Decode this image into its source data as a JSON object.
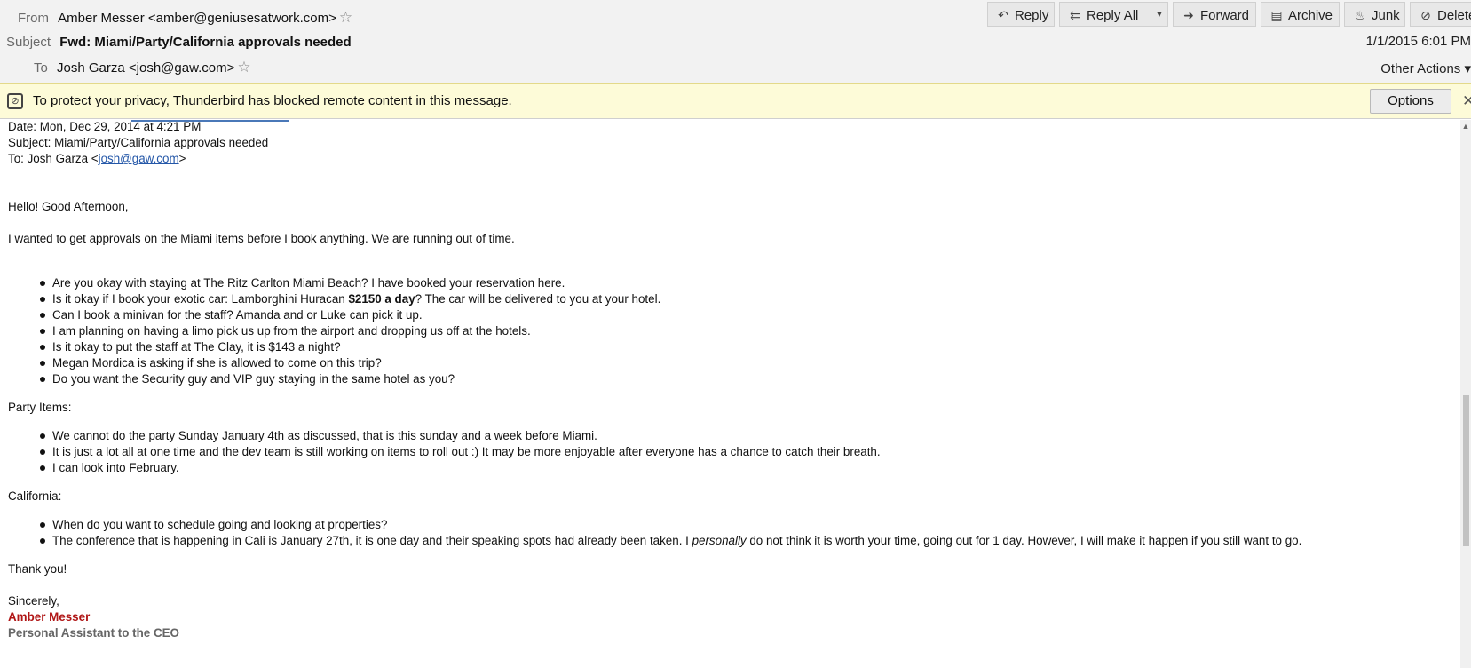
{
  "header": {
    "from_label": "From",
    "from_value": "Amber Messer <amber@geniusesatwork.com>",
    "subject_label": "Subject",
    "subject_value": "Fwd: Miami/Party/California approvals needed",
    "to_label": "To",
    "to_value": "Josh Garza <josh@gaw.com>",
    "date": "1/1/2015 6:01 PM",
    "other_actions": "Other Actions ▾"
  },
  "toolbar": {
    "reply": "Reply",
    "reply_all": "Reply All",
    "forward": "Forward",
    "archive": "Archive",
    "junk": "Junk",
    "delete": "Delete"
  },
  "notification": {
    "text": "To protect your privacy, Thunderbird has blocked remote content in this message.",
    "options": "Options"
  },
  "message": {
    "date_line": "Date: Mon, Dec 29, 2014 at 4:21 PM",
    "subject_line": "Subject: Miami/Party/California approvals needed",
    "to_prefix": "To: Josh Garza <",
    "to_link": "josh@gaw.com",
    "to_suffix": ">",
    "greeting": "Hello! Good Afternoon,",
    "intro": "I wanted to get approvals on the Miami items before I book anything. We are running out of time.",
    "miami_item_1": "Are you okay with staying at The Ritz Carlton Miami Beach? I have booked your reservation here.",
    "miami_item_2_a": "Is it okay if I book your exotic car: Lamborghini Huracan ",
    "miami_item_2_b": "$2150 a day",
    "miami_item_2_c": "? The car will be delivered to you at your hotel.",
    "miami_item_3": "Can I book a minivan for the staff? Amanda and or Luke can pick it up.",
    "miami_item_4": "I am planning on having a limo pick us up from the airport and dropping us off at the hotels.",
    "miami_item_5": "Is it okay to put the staff at The Clay, it is $143 a night?",
    "miami_item_6": "Megan Mordica is asking if she is allowed to come on this trip?",
    "miami_item_7": "Do you want the Security guy and VIP guy staying in the same hotel as you?",
    "party_heading": "Party Items:",
    "party_item_1": "We cannot do the party Sunday January 4th as discussed, that is this sunday and a week before Miami.",
    "party_item_2": "It is just a lot all at one time and the dev team is still working on items to roll out :) It may be more enjoyable after everyone has a chance to catch their breath.",
    "party_item_3": "I can look into February.",
    "california_heading": "California:",
    "ca_item_1": "When do you want to schedule going and looking at properties?",
    "ca_item_2_a": "The conference that is happening in Cali is January 27th, it is one day and their speaking spots had already been taken. I ",
    "ca_item_2_b": "personally",
    "ca_item_2_c": " do not think it is worth your time, going out for 1 day. However, I will make it happen if you still want to go.",
    "thanks": "Thank you!",
    "sincerely": "Sincerely,",
    "sig_name": "Amber Messer",
    "sig_title": "Personal Assistant to the CEO"
  }
}
